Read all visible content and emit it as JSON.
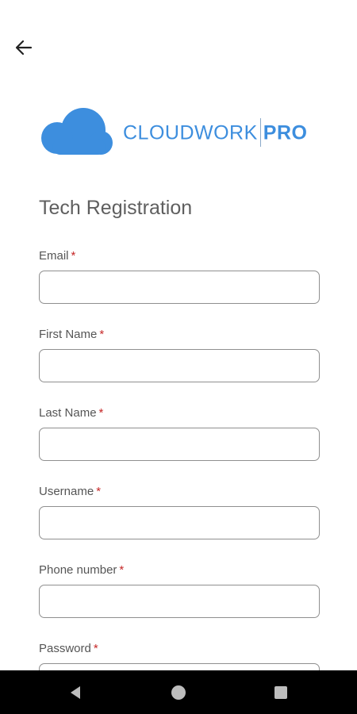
{
  "header": {
    "back_icon": "arrow-left-icon"
  },
  "logo": {
    "brand": "CLOUDWORK",
    "brand_suffix": "PRO",
    "cloud_icon": "cloud-icon",
    "color": "#3d8ede"
  },
  "page": {
    "title": "Tech Registration"
  },
  "form": {
    "required_marker": "*",
    "required_color": "#c62828",
    "fields": [
      {
        "label": "Email",
        "value": ""
      },
      {
        "label": "First Name",
        "value": ""
      },
      {
        "label": "Last Name",
        "value": ""
      },
      {
        "label": "Username",
        "value": ""
      },
      {
        "label": "Phone number",
        "value": ""
      },
      {
        "label": "Password",
        "value": ""
      }
    ]
  },
  "system_nav": {
    "back_icon": "triangle-back-icon",
    "home_icon": "circle-home-icon",
    "recents_icon": "square-recents-icon"
  }
}
